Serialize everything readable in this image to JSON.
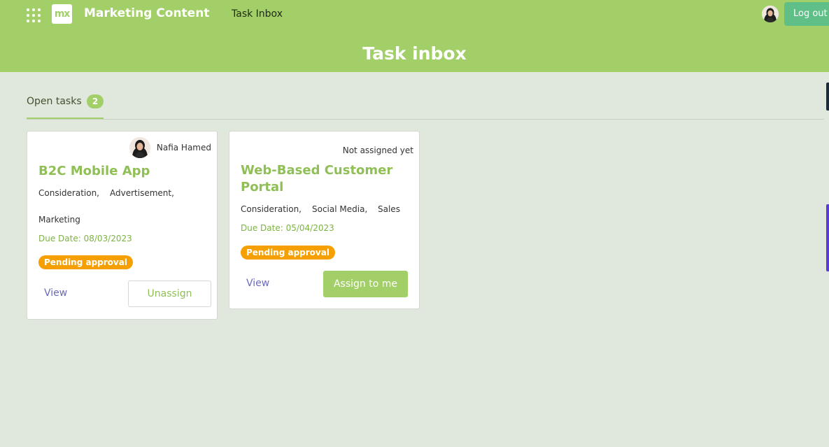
{
  "header": {
    "app_title": "Marketing Content",
    "logo_text": "mx",
    "nav_link": "Task Inbox",
    "logout_label": "Log out",
    "page_title": "Task inbox",
    "accent_color": "#a3cf69"
  },
  "tabs": {
    "open_label": "Open tasks",
    "open_count": "2"
  },
  "tasks": [
    {
      "assignee": "Nafia Hamed",
      "title": "B2C Mobile App",
      "tags": [
        "Consideration,",
        "Advertisement,",
        "Marketing"
      ],
      "due_date": "Due Date: 08/03/2023",
      "status": "Pending approval",
      "view_label": "View",
      "action_label": "Unassign"
    },
    {
      "assignee": "Not assigned yet",
      "title": "Web-Based Customer Portal",
      "tags": [
        "Consideration,",
        "Social Media,",
        "Sales"
      ],
      "due_date": "Due Date: 05/04/2023",
      "status": "Pending approval",
      "view_label": "View",
      "action_label": "Assign to me"
    }
  ],
  "colors": {
    "status_pending": "#f5a000",
    "title_green": "#8fbf55",
    "logout_green": "#5fbf86"
  }
}
